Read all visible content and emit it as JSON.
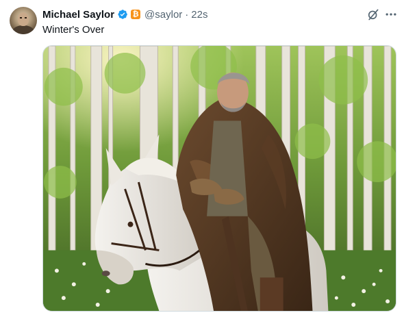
{
  "tweet": {
    "author_name": "Michael Saylor",
    "handle": "@saylor",
    "separator": "·",
    "timestamp": "22s",
    "text": "Winter's Over",
    "badge_glyph": "₿"
  },
  "icons": {
    "verified": "verified-badge-icon",
    "badge": "bitcoin-badge-icon",
    "grok": "grok-icon",
    "more": "more-horizontal-icon"
  },
  "colors": {
    "verified_blue": "#1d9bf0",
    "bitcoin_orange": "#f7931a",
    "secondary_text": "#536471"
  }
}
